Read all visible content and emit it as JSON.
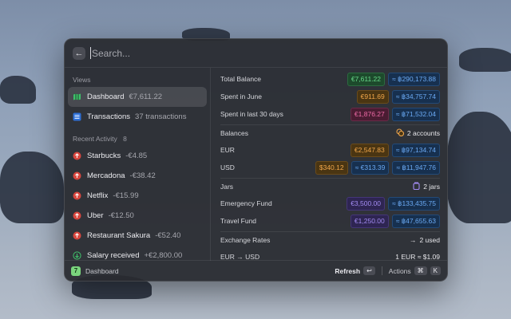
{
  "search": {
    "placeholder": "Search..."
  },
  "left": {
    "views_title": "Views",
    "views": [
      {
        "label": "Dashboard",
        "sub": "€7,611.22"
      },
      {
        "label": "Transactions",
        "sub": "37 transactions"
      }
    ],
    "recent_title": "Recent Activity",
    "recent_count": "8",
    "recent": [
      {
        "label": "Starbucks",
        "sub": "-€4.85"
      },
      {
        "label": "Mercadona",
        "sub": "-€38.42"
      },
      {
        "label": "Netflix",
        "sub": "-€15.99"
      },
      {
        "label": "Uber",
        "sub": "-€12.50"
      },
      {
        "label": "Restaurant Sakura",
        "sub": "-€52.40"
      },
      {
        "label": "Salary received",
        "sub": "+€2,800.00"
      }
    ]
  },
  "right": {
    "total_balance": {
      "label": "Total Balance",
      "eur": "€7,611.22",
      "btc": "≈ ฿290,173.88"
    },
    "spent_june": {
      "label": "Spent in June",
      "eur": "€911.69",
      "btc": "≈ ฿34,757.74"
    },
    "spent_30": {
      "label": "Spent in last 30 days",
      "eur": "€1,876.27",
      "btc": "≈ ฿71,532.04"
    },
    "balances": {
      "title": "Balances",
      "badge": "2 accounts",
      "eur": {
        "label": "EUR",
        "eur": "€2,547.83",
        "btc": "≈ ฿97,134.74"
      },
      "usd": {
        "label": "USD",
        "usd": "$340.12",
        "eur": "≈ €313.39",
        "btc": "≈ ฿11,947.76"
      }
    },
    "jars": {
      "title": "Jars",
      "badge": "2 jars",
      "emergency": {
        "label": "Emergency Fund",
        "eur": "€3,500.00",
        "btc": "≈ ฿133,435.75"
      },
      "travel": {
        "label": "Travel Fund",
        "eur": "€1,250.00",
        "btc": "≈ ฿47,655.63"
      }
    },
    "rates": {
      "title": "Exchange Rates",
      "badge": "2 used",
      "eur_usd": {
        "label": "EUR → USD",
        "value": "1 EUR ≈ $1.09"
      }
    }
  },
  "footer": {
    "app_label": "Dashboard",
    "refresh": "Refresh",
    "refresh_key": "↩",
    "actions": "Actions",
    "actions_key1": "⌘",
    "actions_key2": "K"
  }
}
